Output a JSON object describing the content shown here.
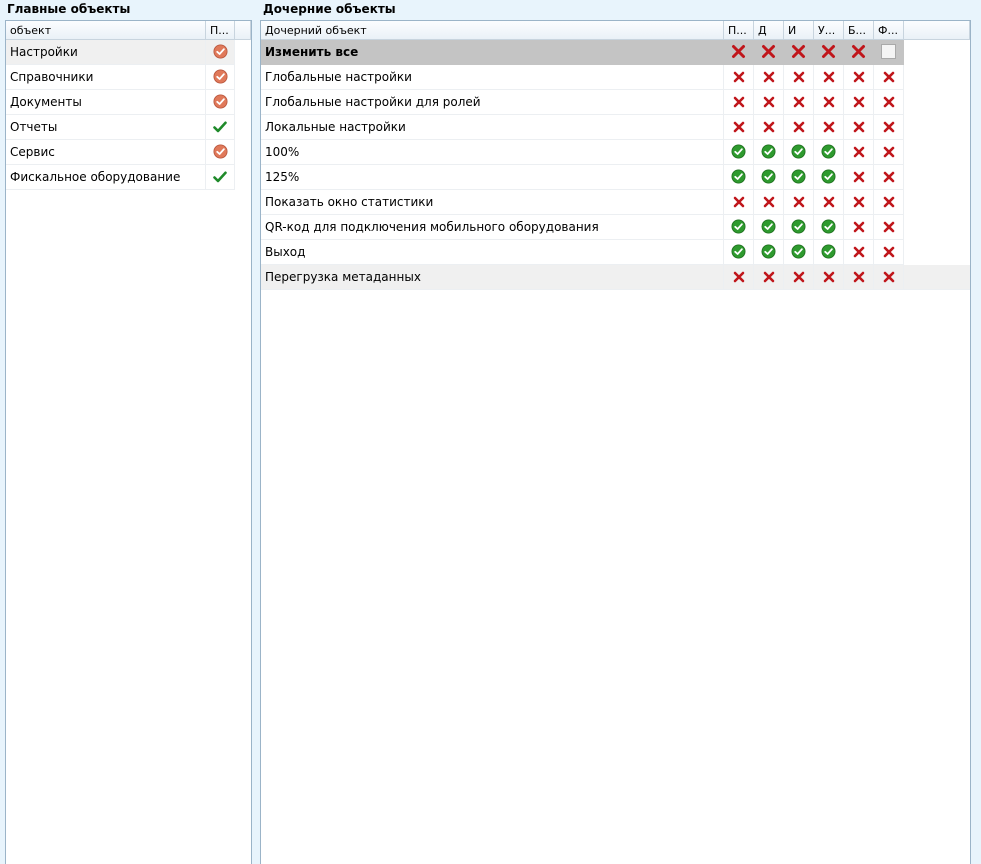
{
  "left_panel": {
    "title": "Главные объекты",
    "columns": [
      "объект",
      "П..."
    ],
    "rows": [
      {
        "label": "Настройки",
        "status": "partial"
      },
      {
        "label": "Справочники",
        "status": "partial"
      },
      {
        "label": "Документы",
        "status": "partial"
      },
      {
        "label": "Отчеты",
        "status": "allowed"
      },
      {
        "label": "Сервис",
        "status": "partial"
      },
      {
        "label": "Фискальное оборудование",
        "status": "allowed"
      }
    ],
    "selected_index": 0
  },
  "right_panel": {
    "title": "Дочерние объекты",
    "columns": [
      "Дочерний объект",
      "П...",
      "Д",
      "И",
      "У...",
      "Б...",
      "Ф..."
    ],
    "all_row": {
      "label": "Изменить все",
      "cells": [
        "deny-big",
        "deny-big",
        "deny-big",
        "deny-big",
        "deny-big",
        "empty"
      ]
    },
    "rows": [
      {
        "label": "Глобальные настройки",
        "cells": [
          "deny",
          "deny",
          "deny",
          "deny",
          "deny",
          "deny"
        ]
      },
      {
        "label": "Глобальные настройки для ролей",
        "cells": [
          "deny",
          "deny",
          "deny",
          "deny",
          "deny",
          "deny"
        ]
      },
      {
        "label": "Локальные настройки",
        "cells": [
          "deny",
          "deny",
          "deny",
          "deny",
          "deny",
          "deny"
        ]
      },
      {
        "label": "100%",
        "cells": [
          "ok",
          "ok",
          "ok",
          "ok",
          "deny",
          "deny"
        ]
      },
      {
        "label": "125%",
        "cells": [
          "ok",
          "ok",
          "ok",
          "ok",
          "deny",
          "deny"
        ]
      },
      {
        "label": "Показать окно статистики",
        "cells": [
          "deny",
          "deny",
          "deny",
          "deny",
          "deny",
          "deny"
        ]
      },
      {
        "label": "QR-код для подключения мобильного оборудования",
        "cells": [
          "ok",
          "ok",
          "ok",
          "ok",
          "deny",
          "deny"
        ]
      },
      {
        "label": "Выход",
        "cells": [
          "ok",
          "ok",
          "ok",
          "ok",
          "deny",
          "deny"
        ]
      },
      {
        "label": "Перегрузка метаданных",
        "cells": [
          "deny",
          "deny",
          "deny",
          "deny",
          "deny",
          "deny"
        ]
      }
    ],
    "highlighted_index": 8
  },
  "colors": {
    "background": "#e8f4fc",
    "deny": "#c0161b",
    "ok": "#2e9a2e",
    "partial": "#e0795a",
    "check": "#1f8a2a"
  }
}
